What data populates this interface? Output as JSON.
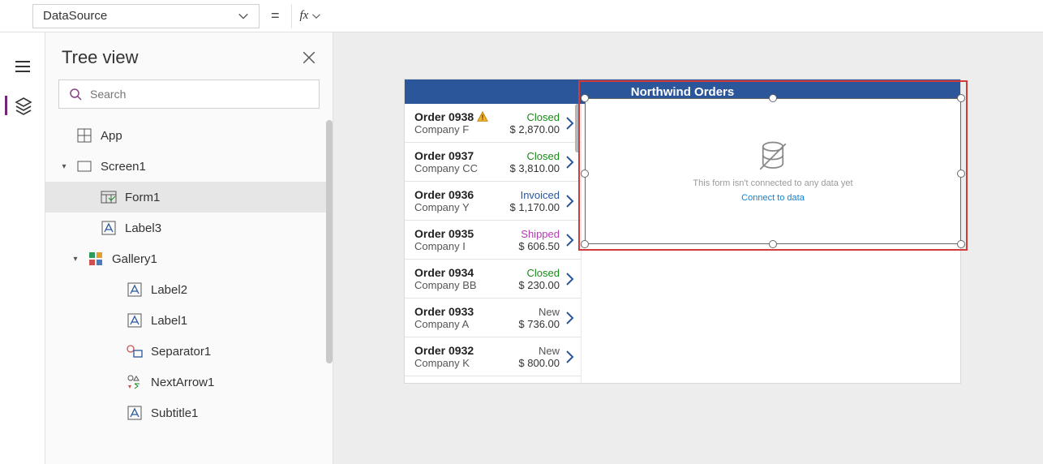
{
  "formula_bar": {
    "property": "DataSource",
    "equals": "=",
    "fx": "fx",
    "value": ""
  },
  "tree": {
    "title": "Tree view",
    "search_placeholder": "Search",
    "items": {
      "app": "App",
      "screen1": "Screen1",
      "form1": "Form1",
      "label3": "Label3",
      "gallery1": "Gallery1",
      "label2": "Label2",
      "label1": "Label1",
      "separator1": "Separator1",
      "nextarrow1": "NextArrow1",
      "subtitle1": "Subtitle1"
    }
  },
  "app": {
    "header": "Northwind Orders",
    "form_empty_msg": "This form isn't connected to any data yet",
    "form_empty_link": "Connect to data",
    "gallery": [
      {
        "title": "Order 0938",
        "warn": true,
        "company": "Company F",
        "status": "Closed",
        "amount": "$ 2,870.00"
      },
      {
        "title": "Order 0937",
        "warn": false,
        "company": "Company CC",
        "status": "Closed",
        "amount": "$ 3,810.00"
      },
      {
        "title": "Order 0936",
        "warn": false,
        "company": "Company Y",
        "status": "Invoiced",
        "amount": "$ 1,170.00"
      },
      {
        "title": "Order 0935",
        "warn": false,
        "company": "Company I",
        "status": "Shipped",
        "amount": "$ 606.50"
      },
      {
        "title": "Order 0934",
        "warn": false,
        "company": "Company BB",
        "status": "Closed",
        "amount": "$ 230.00"
      },
      {
        "title": "Order 0933",
        "warn": false,
        "company": "Company A",
        "status": "New",
        "amount": "$ 736.00"
      },
      {
        "title": "Order 0932",
        "warn": false,
        "company": "Company K",
        "status": "New",
        "amount": "$ 800.00"
      }
    ]
  }
}
